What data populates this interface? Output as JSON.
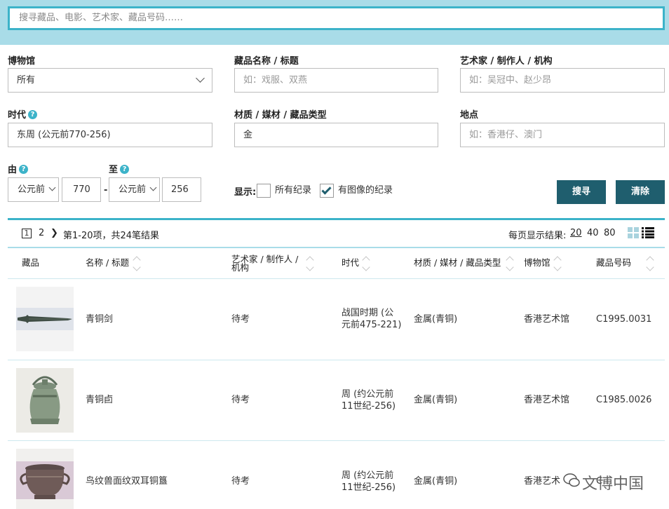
{
  "search": {
    "placeholder": "搜寻藏品、电影、艺术家、藏品号码……"
  },
  "filters": {
    "museum": {
      "label": "博物馆",
      "value": "所有"
    },
    "title": {
      "label": "藏品名称 / 标题",
      "placeholder": "如：戏服、双燕"
    },
    "artist": {
      "label": "艺术家 / 制作人 / 机构",
      "placeholder": "如：吴冠中、赵少昂"
    },
    "period": {
      "label": "时代",
      "help": "?",
      "value": "东周 (公元前770-256)"
    },
    "material": {
      "label": "材质 / 媒材 / 藏品类型",
      "value": "金"
    },
    "place": {
      "label": "地点",
      "placeholder": "如：香港仔、澳门"
    },
    "from": {
      "label": "由",
      "help": "?",
      "era": "公元前",
      "year": "770"
    },
    "separator": "-",
    "to": {
      "label": "至",
      "help": "?",
      "era": "公元前",
      "year": "256"
    },
    "display": {
      "label": "显示:",
      "all_records": "所有纪录",
      "with_images": "有图像的纪录"
    },
    "search_button": "搜寻",
    "clear_button": "清除"
  },
  "results": {
    "pages": [
      "1",
      "2"
    ],
    "summary": "第1-20项，共24笔结果",
    "per_page_label": "每页显示结果:",
    "per_page_options": [
      "20",
      "40",
      "80"
    ],
    "columns": [
      "藏品",
      "名称 / 标题",
      "艺术家 / 制作人 / 机构",
      "时代",
      "材质 / 媒材 / 藏品类型",
      "博物馆",
      "藏品号码"
    ],
    "rows": [
      {
        "name": "青铜剑",
        "artist": "待考",
        "period": "战国时期 (公元前475-221)",
        "material": "金属(青铜)",
        "museum": "香港艺术馆",
        "number": "C1995.0031"
      },
      {
        "name": "青铜卣",
        "artist": "待考",
        "period": "周 (约公元前11世纪-256)",
        "material": "金属(青铜)",
        "museum": "香港艺术馆",
        "number": "C1985.0026"
      },
      {
        "name": "鸟纹兽面纹双耳铜簋",
        "artist": "待考",
        "period": "周 (约公元前11世纪-256)",
        "material": "金属(青铜)",
        "museum": "香港艺术",
        "number": "C"
      }
    ]
  },
  "watermark": "文博中国",
  "colors": {
    "accent": "#3cb3c9",
    "band": "#a9dce8",
    "button": "#1f5e6e"
  }
}
